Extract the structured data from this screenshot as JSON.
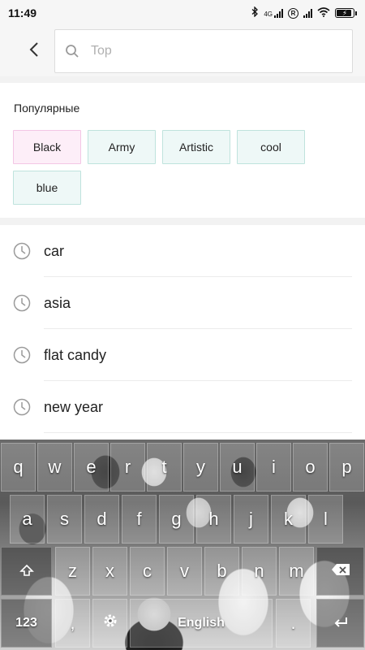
{
  "status_bar": {
    "time": "11:49",
    "signal_label": "4G",
    "roaming_icon": "R",
    "battery_level": 0.8
  },
  "search": {
    "placeholder": "Top"
  },
  "popular": {
    "title": "Популярные",
    "tags": [
      {
        "label": "Black",
        "color": "#fdeef8"
      },
      {
        "label": "Army",
        "color": "#eef8f7"
      },
      {
        "label": "Artistic",
        "color": "#eef8f7"
      },
      {
        "label": "cool",
        "color": "#eef8f7"
      },
      {
        "label": "blue",
        "color": "#eef8f7"
      }
    ]
  },
  "history": {
    "items": [
      "car",
      "asia",
      "flat candy",
      "new year"
    ]
  },
  "keyboard": {
    "row1": [
      "q",
      "w",
      "e",
      "r",
      "t",
      "y",
      "u",
      "i",
      "o",
      "p"
    ],
    "row2": [
      "a",
      "s",
      "d",
      "f",
      "g",
      "h",
      "j",
      "k",
      "l"
    ],
    "row3": [
      "z",
      "x",
      "c",
      "v",
      "b",
      "n",
      "m"
    ],
    "numbers_label": "123",
    "comma_label": ",",
    "space_label": "English",
    "period_label": ".",
    "shift_icon": "shift-icon",
    "backspace_icon": "backspace-icon",
    "settings_icon": "gear-icon",
    "enter_icon": "enter-icon"
  }
}
